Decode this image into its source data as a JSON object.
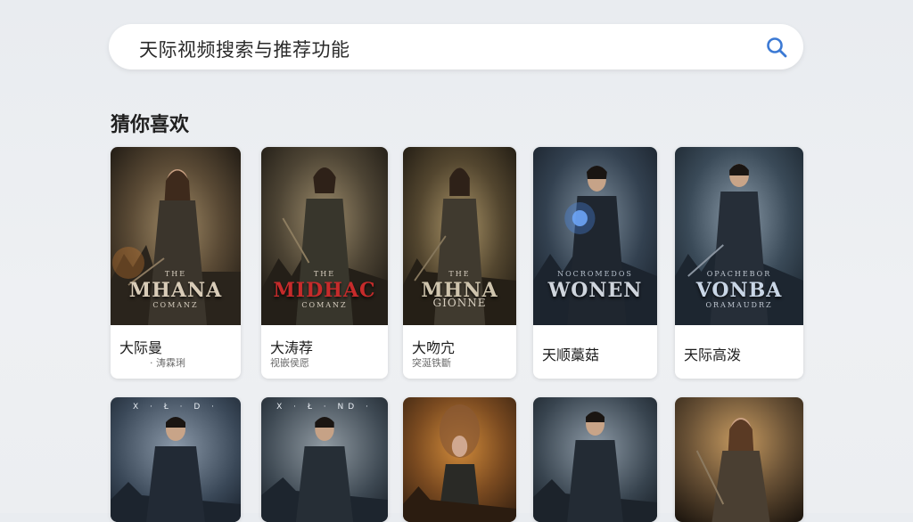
{
  "search": {
    "text": "天际视频搜索与推荐功能"
  },
  "section": {
    "title": "猜你喜欢"
  },
  "row1": [
    {
      "name": "大际曼",
      "sub": "· 涛霖琍",
      "poster_small_top": "THE",
      "poster_title": "MHANA",
      "poster_small_bottom": "COMANZ",
      "title_color": "#d9ccb8"
    },
    {
      "name": "大涛荐",
      "sub": "视嵌侯愿",
      "poster_small_top": "THE",
      "poster_title": "MIDHAC",
      "poster_small_bottom": "COMANZ",
      "title_color": "#c62b2b"
    },
    {
      "name": "大吻宂",
      "sub": "突涎铁斷",
      "poster_small_top": "THE",
      "poster_title": "MHNA",
      "poster_small_bottom": "GIONNE",
      "title_color": "#cfc4ad"
    },
    {
      "name": "天顺藁菇",
      "sub": "",
      "poster_small_top": "NOCROMEDOS",
      "poster_title": "WONEN",
      "poster_small_bottom": "",
      "title_color": "#cfd5dd"
    },
    {
      "name": "天际高泼",
      "sub": "",
      "poster_small_top": "OPACHEBOR",
      "poster_title": "VONBA",
      "poster_small_bottom": "ORAMAUDRZ",
      "title_color": "#c9d6e6"
    }
  ],
  "row2": [
    {
      "poster_top": "X · Ł · D ·"
    },
    {
      "poster_top": "X · Ł · ND ·"
    },
    {
      "poster_top": ""
    },
    {
      "poster_top": ""
    },
    {
      "poster_top": ""
    }
  ]
}
